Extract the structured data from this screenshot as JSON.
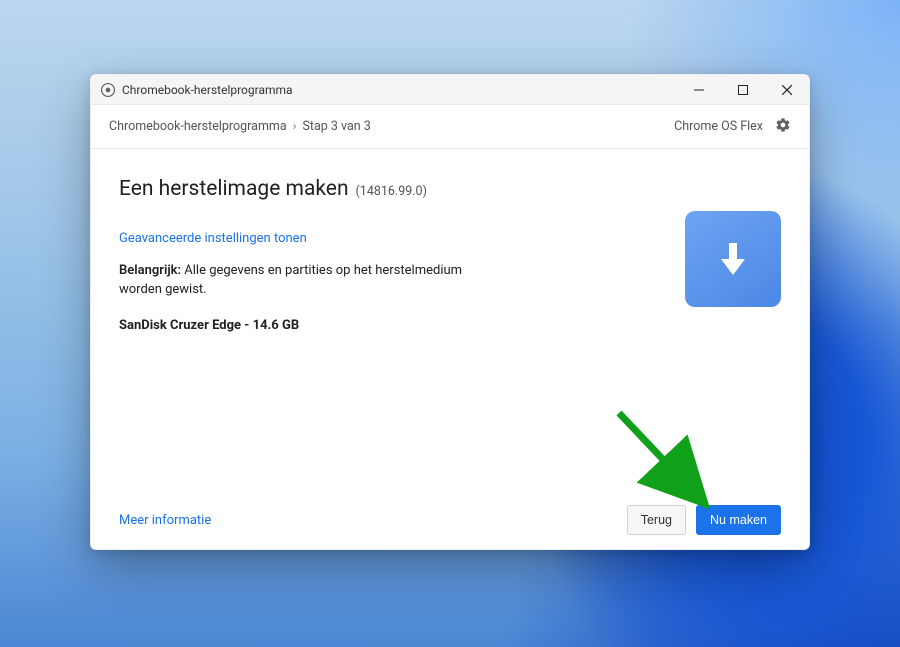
{
  "titlebar": {
    "app_title": "Chromebook-herstelprogramma"
  },
  "header": {
    "breadcrumb1": "Chromebook-herstelprogramma",
    "breadcrumb2": "Stap 3 van 3",
    "product": "Chrome OS Flex"
  },
  "main": {
    "heading": "Een herstelimage maken",
    "version": "(14816.99.0)",
    "advanced_link": "Geavanceerde instellingen tonen",
    "warning_label": "Belangrijk:",
    "warning_text": " Alle gegevens en partities op het herstelmedium worden gewist.",
    "media_label": "SanDisk Cruzer Edge - 14.6 GB"
  },
  "footer": {
    "more_link": "Meer informatie",
    "back_btn": "Terug",
    "create_btn": "Nu maken"
  },
  "colors": {
    "primary": "#1a73e8",
    "annotation": "#11a01a"
  }
}
